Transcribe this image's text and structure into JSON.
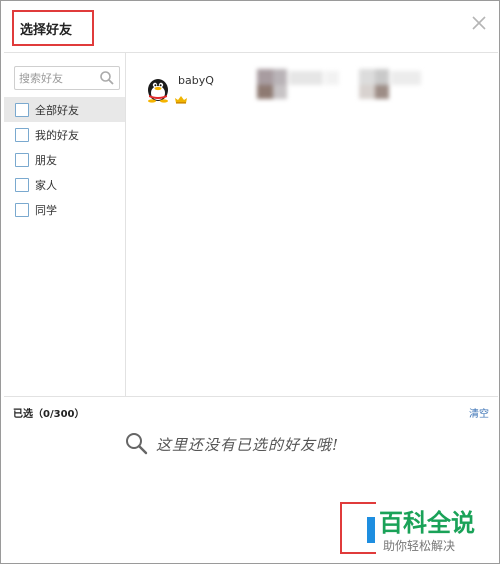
{
  "dialog": {
    "title": "选择好友"
  },
  "sidebar": {
    "search_placeholder": "搜索好友",
    "groups": [
      {
        "label": "全部好友",
        "active": true
      },
      {
        "label": "我的好友",
        "active": false
      },
      {
        "label": "朋友",
        "active": false
      },
      {
        "label": "家人",
        "active": false
      },
      {
        "label": "同学",
        "active": false
      }
    ]
  },
  "friends": [
    {
      "name": "babyQ",
      "avatar": "penguin-avatar",
      "badge": "vip-crown-icon"
    }
  ],
  "selection": {
    "count_label": "已选（0/300）",
    "clear_label": "清空",
    "empty_text": "这里还没有已选的好友哦!"
  },
  "watermark": {
    "title": "百科全说",
    "subtitle": "助你轻松解决"
  },
  "colors": {
    "accent_blue": "#1e8ee0",
    "link_blue": "#3a72b5",
    "highlight_red": "#e03b3b",
    "watermark_green": "#1aa258",
    "checkbox_border": "#7aa9cf",
    "active_row": "#e8e8e8"
  }
}
